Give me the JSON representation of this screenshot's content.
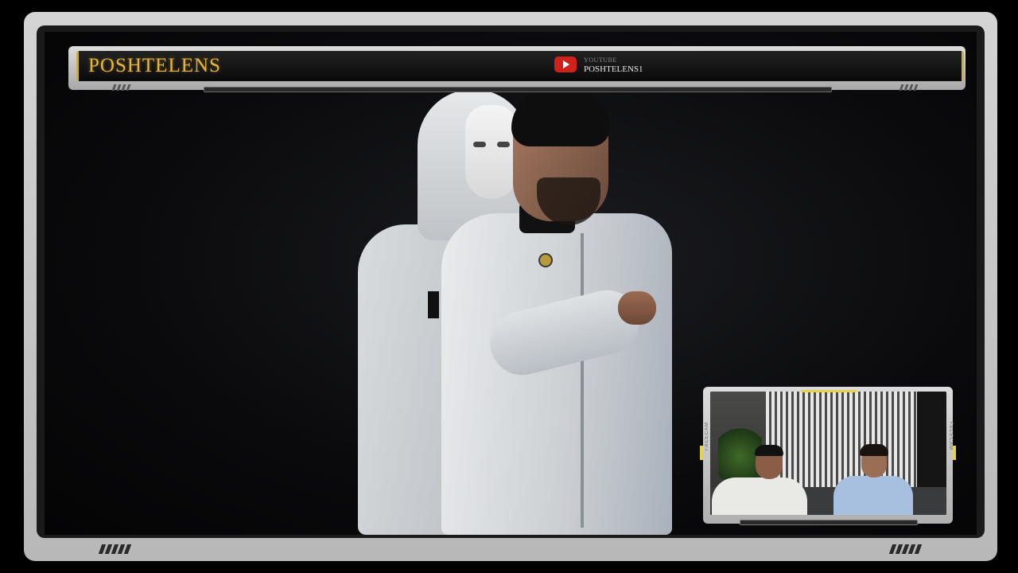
{
  "overlay": {
    "brand_title": "POSHTELENS",
    "social": {
      "platform_label": "YOUTUBE",
      "handle": "POSHTELENS1",
      "icon": "youtube-play-icon",
      "icon_color": "#d0211c"
    },
    "accent_color": "#e8b73a"
  },
  "facecam": {
    "side_label_left": "FACECAM",
    "side_label_right": "FACECAM",
    "accent_color": "#e7d34a"
  }
}
